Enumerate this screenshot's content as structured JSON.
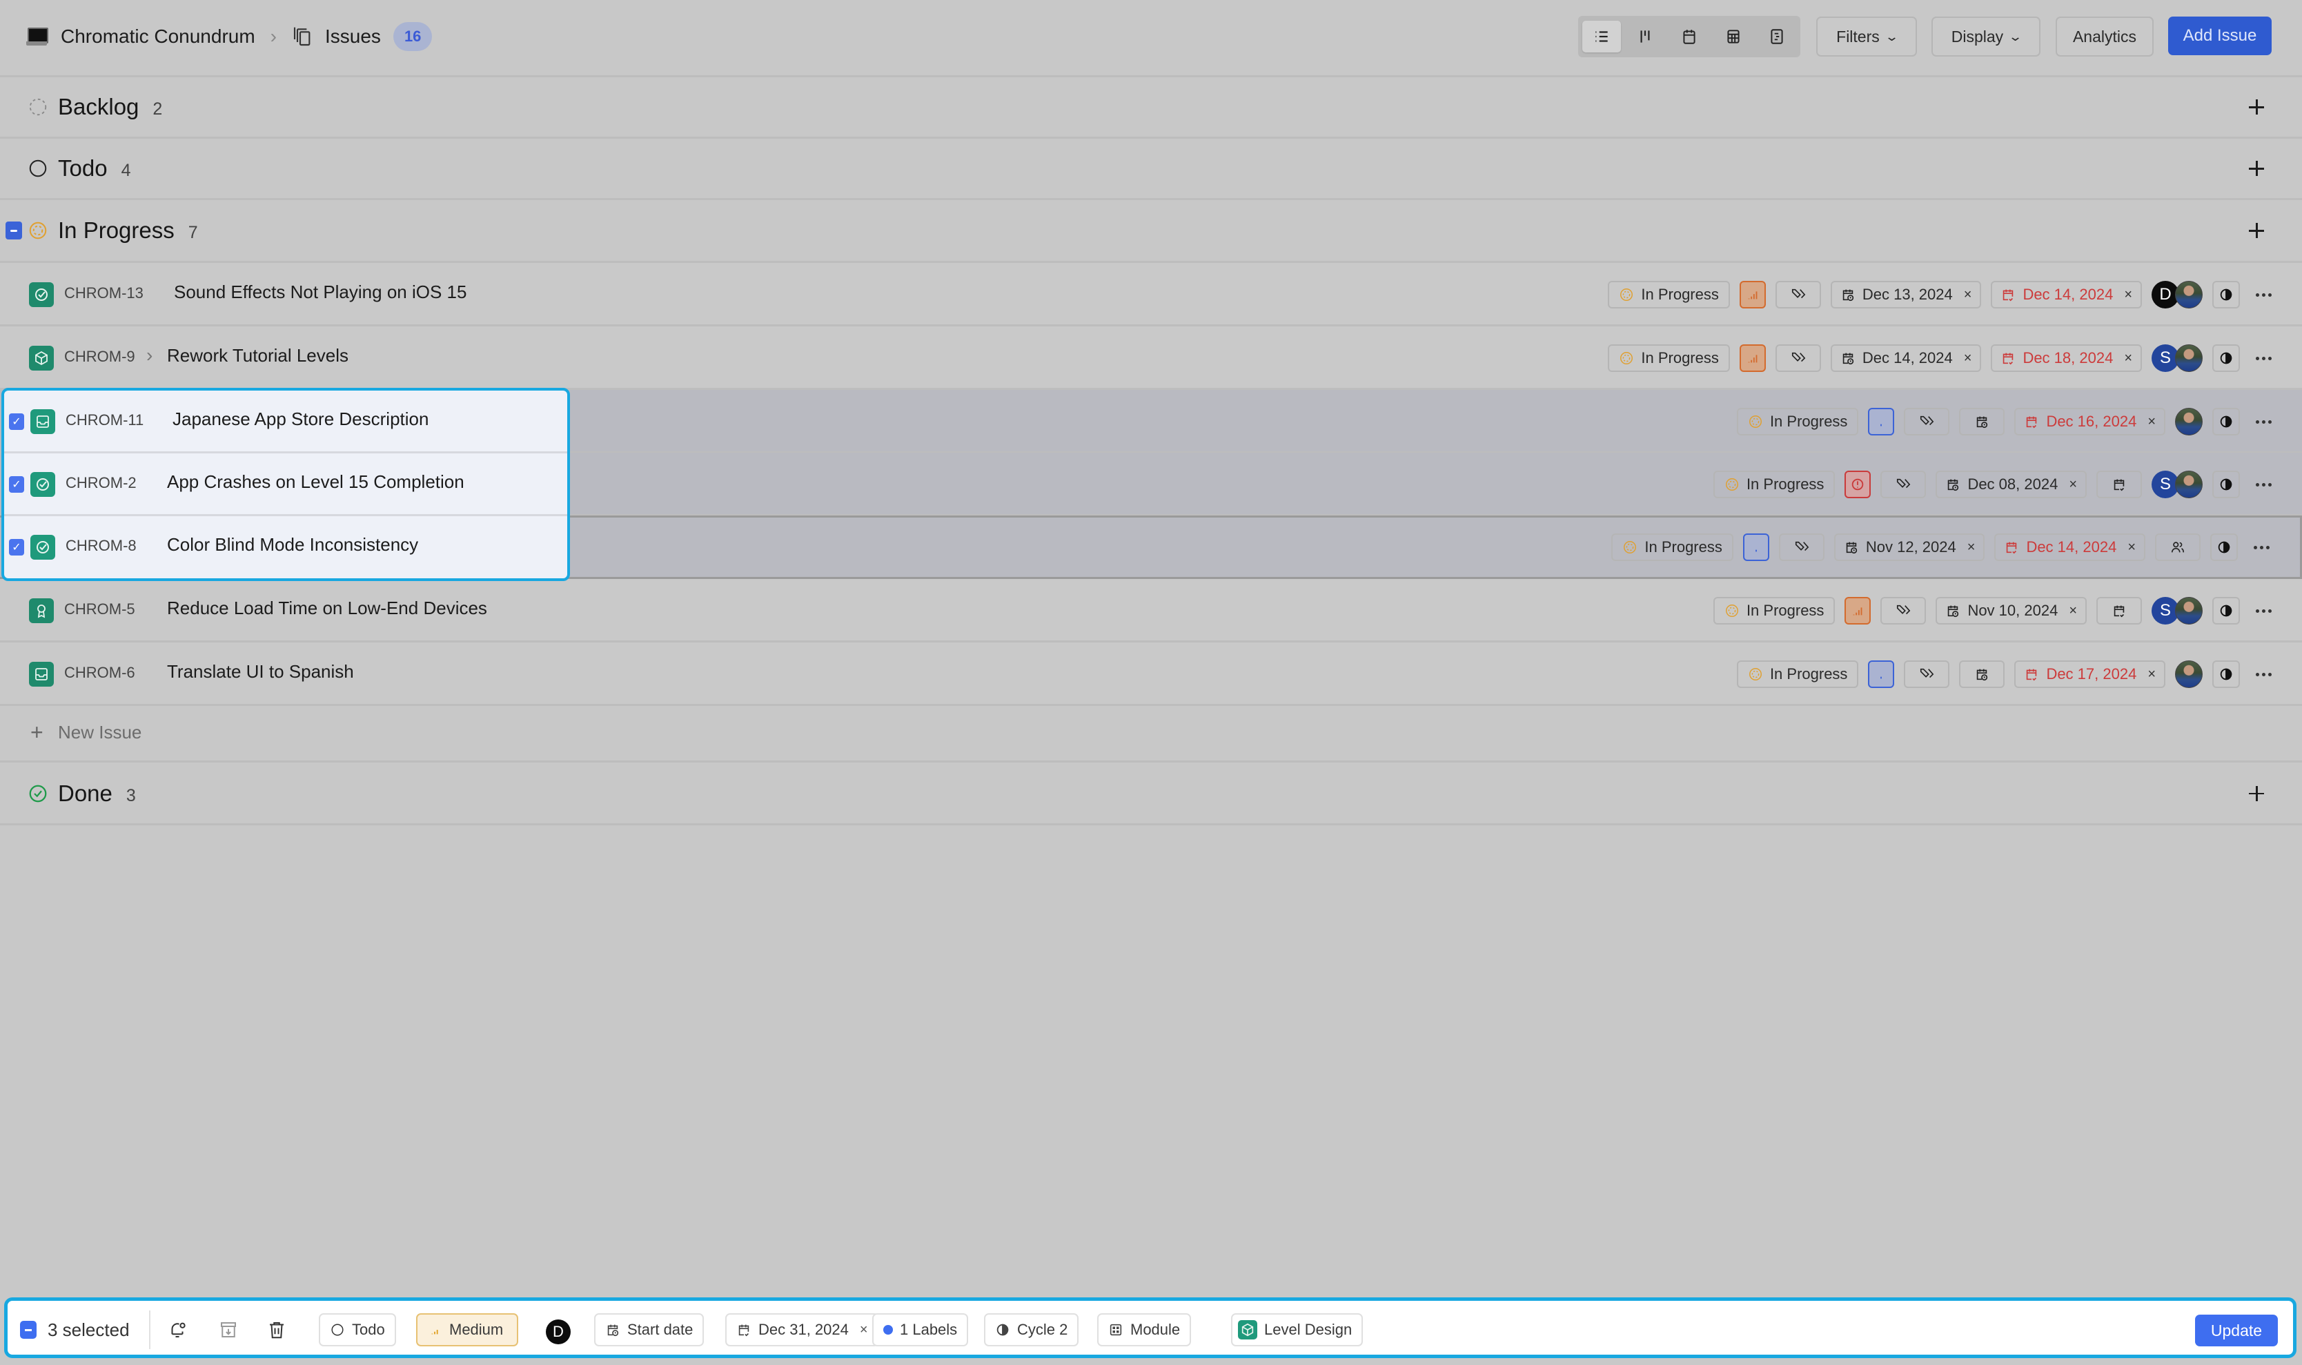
{
  "header": {
    "project_name": "Chromatic Conundrum",
    "section": "Issues",
    "issue_count": "16",
    "view_modes": [
      "list",
      "kanban",
      "calendar",
      "spreadsheet",
      "gantt"
    ],
    "active_view": "list",
    "filters_label": "Filters",
    "display_label": "Display",
    "analytics_label": "Analytics",
    "add_issue_label": "Add Issue"
  },
  "groups": {
    "backlog": {
      "title": "Backlog",
      "count": "2"
    },
    "todo": {
      "title": "Todo",
      "count": "4"
    },
    "in_progress": {
      "title": "In Progress",
      "count": "7"
    },
    "done": {
      "title": "Done",
      "count": "3"
    }
  },
  "issues": [
    {
      "id": "CHROM-13",
      "title": "Sound Effects Not Playing on iOS 15",
      "type_icon": "check-circle-icon",
      "state": "In Progress",
      "priority": "high",
      "start_date": "Dec 13, 2024",
      "due_date": "Dec 14, 2024",
      "assignees": [
        "D",
        "photo"
      ],
      "selected": false
    },
    {
      "id": "CHROM-9",
      "title": "Rework Tutorial Levels",
      "type_icon": "cube-icon",
      "has_sub_issues": true,
      "state": "In Progress",
      "priority": "high",
      "start_date": "Dec 14, 2024",
      "due_date": "Dec 18, 2024",
      "assignees": [
        "S",
        "photo"
      ],
      "selected": false
    },
    {
      "id": "CHROM-11",
      "title": "Japanese App Store Description",
      "type_icon": "inbox-icon",
      "state": "In Progress",
      "priority": "low",
      "start_date": "",
      "due_date": "Dec 16, 2024",
      "assignees": [
        "photo"
      ],
      "selected": true
    },
    {
      "id": "CHROM-2",
      "title": "App Crashes on Level 15 Completion",
      "type_icon": "check-circle-icon",
      "state": "In Progress",
      "priority": "urgent",
      "start_date": "Dec 08, 2024",
      "due_date": "",
      "assignees": [
        "S",
        "photo"
      ],
      "selected": true
    },
    {
      "id": "CHROM-8",
      "title": "Color Blind Mode Inconsistency",
      "type_icon": "check-circle-icon",
      "state": "In Progress",
      "priority": "low",
      "start_date": "Nov 12, 2024",
      "due_date": "Dec 14, 2024",
      "assignees": [],
      "selected": true
    },
    {
      "id": "CHROM-5",
      "title": "Reduce Load Time on Low-End Devices",
      "type_icon": "award-icon",
      "state": "In Progress",
      "priority": "high",
      "start_date": "Nov 10, 2024",
      "due_date": "",
      "assignees": [
        "S",
        "photo"
      ],
      "selected": false
    },
    {
      "id": "CHROM-6",
      "title": "Translate UI to Spanish",
      "type_icon": "inbox-icon",
      "state": "In Progress",
      "priority": "low",
      "start_date": "",
      "due_date": "Dec 17, 2024",
      "assignees": [
        "photo"
      ],
      "selected": false
    }
  ],
  "new_issue_label": "New Issue",
  "bulk_bar": {
    "selected_text": "3 selected",
    "state": "Todo",
    "priority": "Medium",
    "assignee": "D",
    "start_date": "Start date",
    "due_date": "Dec 31, 2024",
    "labels": "1 Labels",
    "cycle": "Cycle 2",
    "module": "Module",
    "issue_type": "Level Design",
    "update_label": "Update"
  },
  "colors": {
    "accent": "#3e6ef0",
    "selection_outline": "#18a8e0",
    "overdue": "#cc3b3b",
    "in_progress": "#e0a030",
    "done": "#1f9a4a",
    "priority_high": "#d36b2e",
    "priority_low": "#3c63d6",
    "priority_urgent": "#c93b3b"
  }
}
